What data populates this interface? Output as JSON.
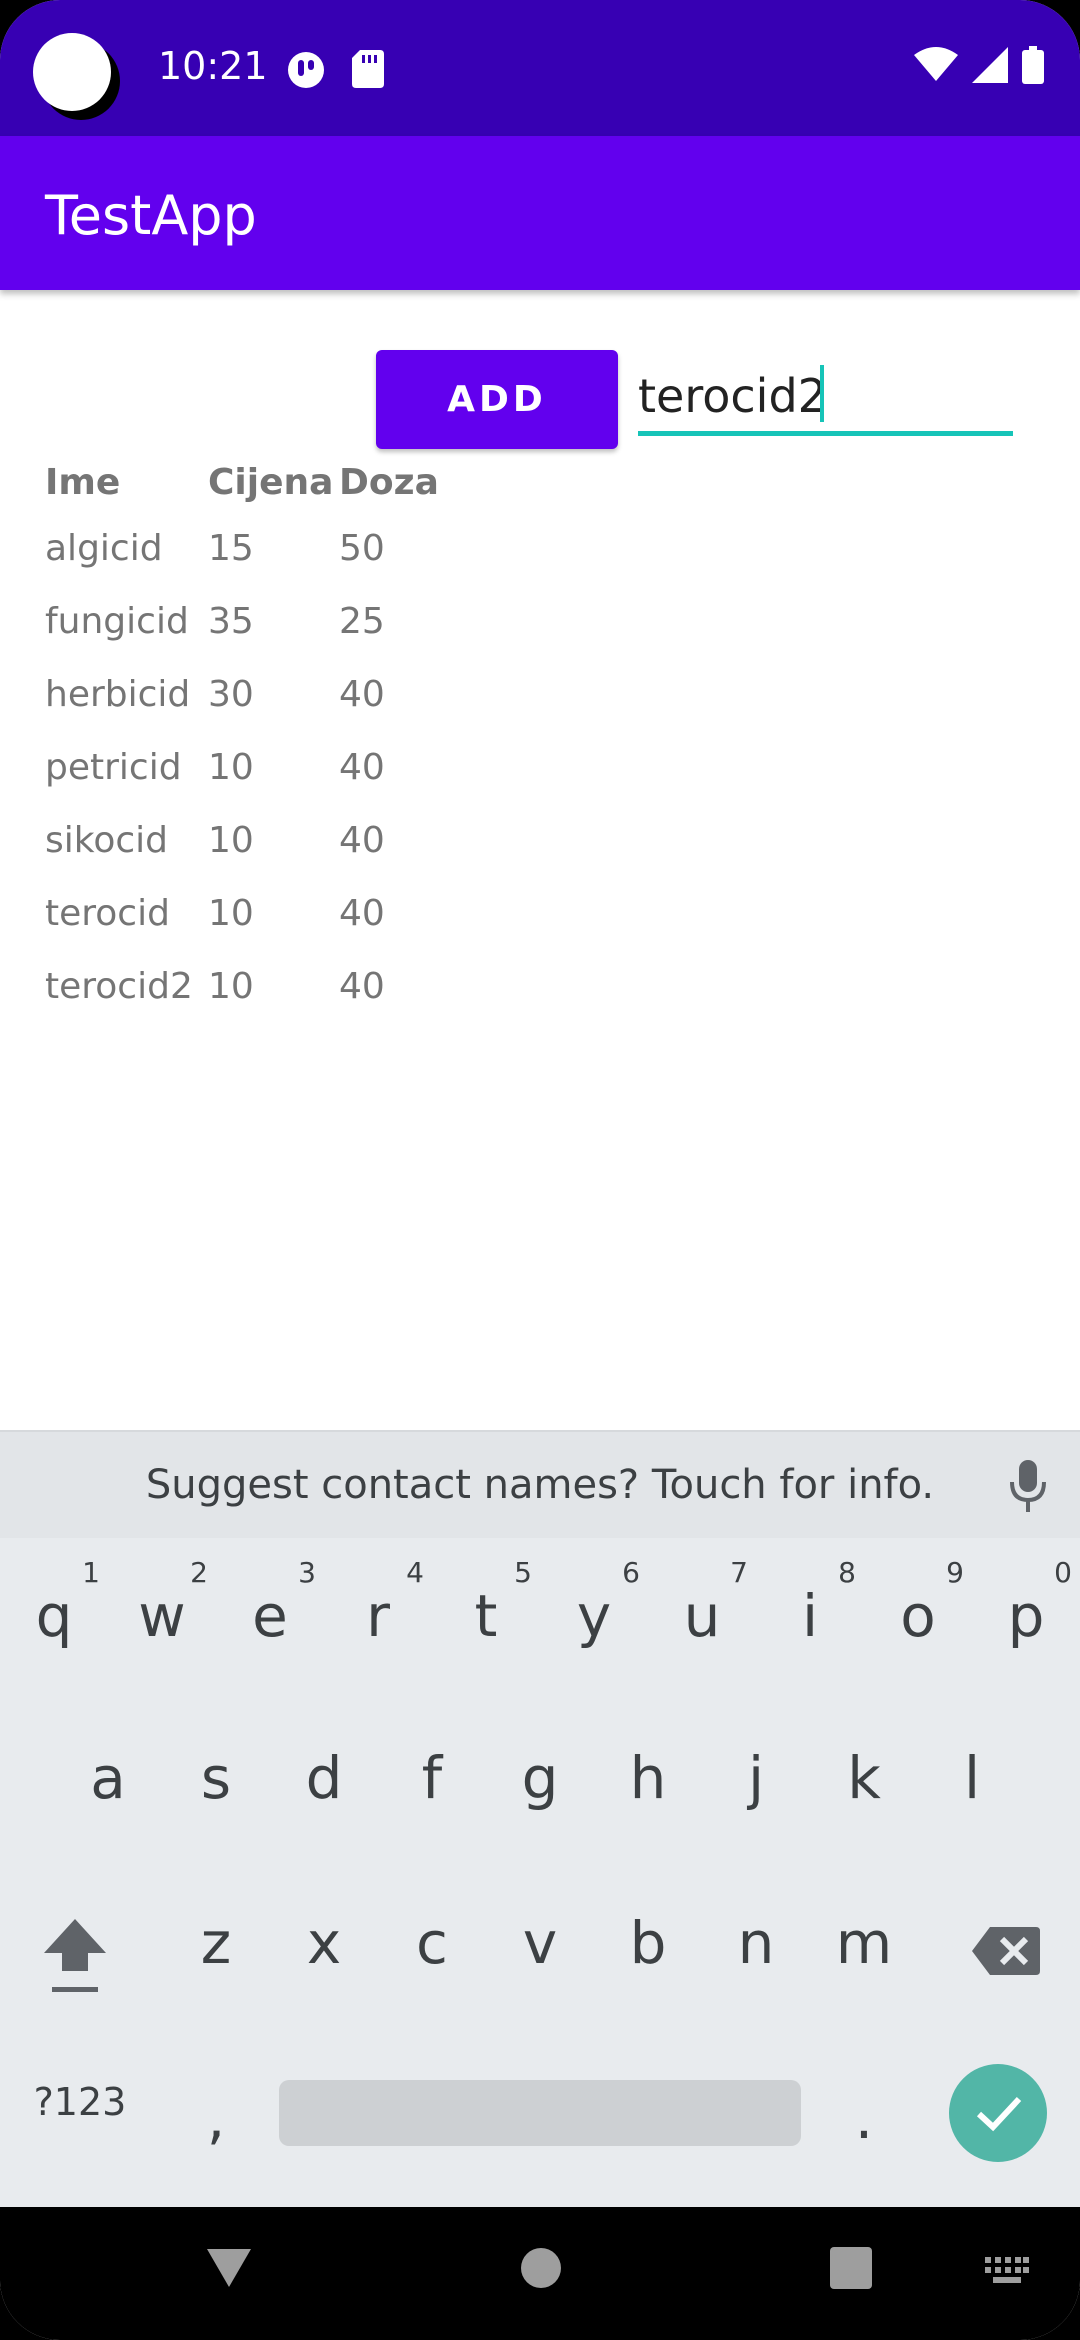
{
  "status_bar": {
    "time": "10:21"
  },
  "app_bar": {
    "title": "TestApp"
  },
  "form": {
    "add_label": "ADD",
    "input_value": "terocid2"
  },
  "table": {
    "headers": [
      "Ime",
      "Cijena",
      "Doza"
    ],
    "rows": [
      [
        "algicid",
        "15",
        "50"
      ],
      [
        "fungicid",
        "35",
        "25"
      ],
      [
        "herbicid",
        "30",
        "40"
      ],
      [
        "petricid",
        "10",
        "40"
      ],
      [
        "sikocid",
        "10",
        "40"
      ],
      [
        "terocid",
        "10",
        "40"
      ],
      [
        "terocid2",
        "10",
        "40"
      ]
    ]
  },
  "keyboard": {
    "suggestion": "Suggest contact names? Touch for info.",
    "row1": [
      {
        "key": "q",
        "hint": "1"
      },
      {
        "key": "w",
        "hint": "2"
      },
      {
        "key": "e",
        "hint": "3"
      },
      {
        "key": "r",
        "hint": "4"
      },
      {
        "key": "t",
        "hint": "5"
      },
      {
        "key": "y",
        "hint": "6"
      },
      {
        "key": "u",
        "hint": "7"
      },
      {
        "key": "i",
        "hint": "8"
      },
      {
        "key": "o",
        "hint": "9"
      },
      {
        "key": "p",
        "hint": "0"
      }
    ],
    "row2": [
      "a",
      "s",
      "d",
      "f",
      "g",
      "h",
      "j",
      "k",
      "l"
    ],
    "row3": [
      "z",
      "x",
      "c",
      "v",
      "b",
      "n",
      "m"
    ],
    "symbols_label": "?123",
    "comma": ",",
    "period": "."
  },
  "colors": {
    "status_bar": "#3700b3",
    "primary": "#6200ee",
    "accent": "#16c4b8",
    "enter_key": "#52b6a7"
  }
}
